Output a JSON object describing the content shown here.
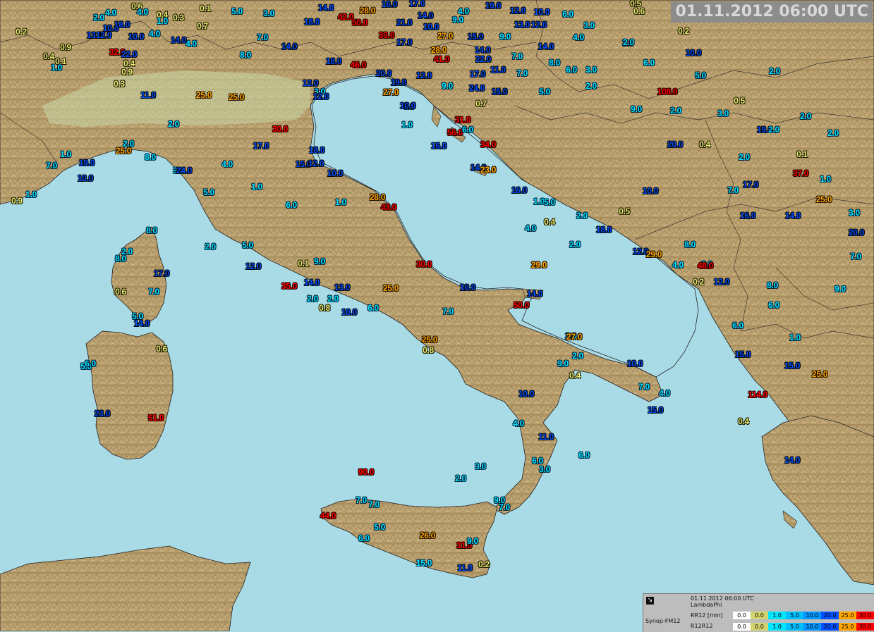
{
  "header": {
    "timestamp": "01.11.2012 06:00 UTC"
  },
  "legend": {
    "icon": "arrow-icon",
    "time": "01.11.2012 06:00 UTC",
    "projection": "LambdaPhi",
    "row1_label": "RR12 [mm]",
    "row2_label": "R12R12",
    "brand": "Synop-FM12",
    "swatches": [
      {
        "label": "0.0",
        "color": "#ffffff",
        "text": "#000000"
      },
      {
        "label": "0.0",
        "color": "#d2d26e",
        "text": "#000000"
      },
      {
        "label": "1.0",
        "color": "#00e6ff",
        "text": "#000000"
      },
      {
        "label": "5.0",
        "color": "#00bfff",
        "text": "#000000"
      },
      {
        "label": "10.0",
        "color": "#0096ff",
        "text": "#000000"
      },
      {
        "label": "20.0",
        "color": "#0050ff",
        "text": "#000000"
      },
      {
        "label": "25.0",
        "color": "#ffa500",
        "text": "#000000"
      },
      {
        "label": "30.0",
        "color": "#ff0000",
        "text": "#000000"
      }
    ]
  },
  "observations": [
    {
      "v": "4.0",
      "c": "c"
    },
    {
      "v": "0.6",
      "c": "y"
    },
    {
      "v": "4.0",
      "c": "c"
    },
    {
      "v": "0.4",
      "c": "y"
    },
    {
      "v": "0.3",
      "c": "y"
    },
    {
      "v": "0.1",
      "c": "y"
    },
    {
      "v": "5.0",
      "c": "c"
    },
    {
      "v": "3.0",
      "c": "c"
    },
    {
      "v": "14.0",
      "c": "b"
    },
    {
      "v": "42.0",
      "c": "r"
    },
    {
      "v": "28.0",
      "c": "o"
    },
    {
      "v": "16.0",
      "c": "b"
    },
    {
      "v": "17.0",
      "c": "b"
    },
    {
      "v": "4.0",
      "c": "c"
    },
    {
      "v": "19.0",
      "c": "b"
    },
    {
      "v": "12.0",
      "c": "b"
    },
    {
      "v": "10.0",
      "c": "b"
    },
    {
      "v": "6.0",
      "c": "c"
    },
    {
      "v": "0.5",
      "c": "y"
    },
    {
      "v": "0.6",
      "c": "y"
    },
    {
      "v": "0.2",
      "c": "y"
    },
    {
      "v": "2.0",
      "c": "c"
    },
    {
      "v": "10.0",
      "c": "b"
    },
    {
      "v": "18.0",
      "c": "b"
    },
    {
      "v": "1.0",
      "c": "c"
    },
    {
      "v": "0.7",
      "c": "y"
    },
    {
      "v": "18.0",
      "c": "b"
    },
    {
      "v": "50.0",
      "c": "r"
    },
    {
      "v": "21.0",
      "c": "b"
    },
    {
      "v": "14.0",
      "c": "b"
    },
    {
      "v": "9.0",
      "c": "c"
    },
    {
      "v": "10.0",
      "c": "b"
    },
    {
      "v": "13.0",
      "c": "b"
    },
    {
      "v": "3.0",
      "c": "c"
    },
    {
      "v": "0.2",
      "c": "y"
    },
    {
      "v": "13.0",
      "c": "b"
    },
    {
      "v": "12.0",
      "c": "b"
    },
    {
      "v": "10.0",
      "c": "b"
    },
    {
      "v": "14.0",
      "c": "b"
    },
    {
      "v": "4.0",
      "c": "c"
    },
    {
      "v": "7.0",
      "c": "c"
    },
    {
      "v": "33.0",
      "c": "r"
    },
    {
      "v": "17.0",
      "c": "b"
    },
    {
      "v": "27.0",
      "c": "o"
    },
    {
      "v": "15.0",
      "c": "b"
    },
    {
      "v": "9.0",
      "c": "c"
    },
    {
      "v": "12.0",
      "c": "b"
    },
    {
      "v": "4.0",
      "c": "c"
    },
    {
      "v": "3.0",
      "c": "c"
    },
    {
      "v": "0.9",
      "c": "y"
    },
    {
      "v": "32.0",
      "c": "r"
    },
    {
      "v": "22.0",
      "c": "b"
    },
    {
      "v": "14.0",
      "c": "b"
    },
    {
      "v": "4.0",
      "c": "c"
    },
    {
      "v": "8.0",
      "c": "c"
    },
    {
      "v": "14.0",
      "c": "b"
    },
    {
      "v": "28.0",
      "c": "o"
    },
    {
      "v": "14.0",
      "c": "b"
    },
    {
      "v": "10.0",
      "c": "b"
    },
    {
      "v": "0.4",
      "c": "y"
    },
    {
      "v": "0.1",
      "c": "y"
    },
    {
      "v": "1.0",
      "c": "c"
    },
    {
      "v": "0.4",
      "c": "y"
    },
    {
      "v": "18.0",
      "c": "b"
    },
    {
      "v": "46.0",
      "c": "r"
    },
    {
      "v": "41.0",
      "c": "r"
    },
    {
      "v": "22.0",
      "c": "b"
    },
    {
      "v": "7.0",
      "c": "c"
    },
    {
      "v": "8.0",
      "c": "c"
    },
    {
      "v": "6.0",
      "c": "c"
    },
    {
      "v": "0.9",
      "c": "y"
    },
    {
      "v": "20.0",
      "c": "b"
    },
    {
      "v": "12.0",
      "c": "b"
    },
    {
      "v": "17.0",
      "c": "b"
    },
    {
      "v": "11.0",
      "c": "b"
    },
    {
      "v": "7.0",
      "c": "c"
    },
    {
      "v": "6.0",
      "c": "c"
    },
    {
      "v": "3.0",
      "c": "c"
    },
    {
      "v": "5.0",
      "c": "c"
    },
    {
      "v": "2.0",
      "c": "c"
    },
    {
      "v": "0.3",
      "c": "y"
    },
    {
      "v": "11.0",
      "c": "b"
    },
    {
      "v": "25.0",
      "c": "o"
    },
    {
      "v": "25.0",
      "c": "o"
    },
    {
      "v": "12.0",
      "c": "b"
    },
    {
      "v": "19.0",
      "c": "b"
    },
    {
      "v": "9.0",
      "c": "c"
    },
    {
      "v": "24.0",
      "c": "b"
    },
    {
      "v": "15.0",
      "c": "b"
    },
    {
      "v": "5.0",
      "c": "c"
    },
    {
      "v": "2.0",
      "c": "c"
    },
    {
      "v": "2.0",
      "c": "c"
    },
    {
      "v": "3.0",
      "c": "c"
    },
    {
      "v": "27.0",
      "c": "o"
    },
    {
      "v": "12.0",
      "c": "b"
    },
    {
      "v": "0.5",
      "c": "y"
    },
    {
      "v": "0.7",
      "c": "y"
    },
    {
      "v": "9.0",
      "c": "c"
    },
    {
      "v": "10.0",
      "c": "b"
    },
    {
      "v": "108.0",
      "c": "r"
    },
    {
      "v": "9.0",
      "c": "c"
    },
    {
      "v": "2.0",
      "c": "c"
    },
    {
      "v": "3.0",
      "c": "c"
    },
    {
      "v": "2.0",
      "c": "c"
    },
    {
      "v": "2.0",
      "c": "c"
    },
    {
      "v": "31.0",
      "c": "r"
    },
    {
      "v": "1.0",
      "c": "c"
    },
    {
      "v": "56.0",
      "c": "r"
    },
    {
      "v": "6.0",
      "c": "c"
    },
    {
      "v": "30.0",
      "c": "r"
    },
    {
      "v": "19.0",
      "c": "b"
    },
    {
      "v": "2.0",
      "c": "c"
    },
    {
      "v": "2.0",
      "c": "c"
    },
    {
      "v": "2.0",
      "c": "c"
    },
    {
      "v": "25.0",
      "c": "o"
    },
    {
      "v": "17.0",
      "c": "b"
    },
    {
      "v": "15.0",
      "c": "b"
    },
    {
      "v": "34.0",
      "c": "r"
    },
    {
      "v": "20.0",
      "c": "b"
    },
    {
      "v": "0.4",
      "c": "y"
    },
    {
      "v": "2.0",
      "c": "c"
    },
    {
      "v": "0.1",
      "c": "y"
    },
    {
      "v": "1.0",
      "c": "c"
    },
    {
      "v": "8.0",
      "c": "c"
    },
    {
      "v": "18.0",
      "c": "b"
    },
    {
      "v": "15.0",
      "c": "b"
    },
    {
      "v": "19.0",
      "c": "b"
    },
    {
      "v": "4.0",
      "c": "c"
    },
    {
      "v": "7.0",
      "c": "c"
    },
    {
      "v": "12.0",
      "c": "b"
    },
    {
      "v": "10.0",
      "c": "b"
    },
    {
      "v": "14.0",
      "c": "b"
    },
    {
      "v": "23.0",
      "c": "o"
    },
    {
      "v": "37.0",
      "c": "r"
    },
    {
      "v": "3.0",
      "c": "c"
    },
    {
      "v": "24.0",
      "c": "b"
    },
    {
      "v": "10.0",
      "c": "b"
    },
    {
      "v": "5.0",
      "c": "c"
    },
    {
      "v": "1.0",
      "c": "c"
    },
    {
      "v": "16.0",
      "c": "b"
    },
    {
      "v": "10.0",
      "c": "b"
    },
    {
      "v": "7.0",
      "c": "c"
    },
    {
      "v": "17.0",
      "c": "b"
    },
    {
      "v": "1.0",
      "c": "c"
    },
    {
      "v": "0.9",
      "c": "y"
    },
    {
      "v": "1.0",
      "c": "c"
    },
    {
      "v": "6.0",
      "c": "c"
    },
    {
      "v": "1.0",
      "c": "c"
    },
    {
      "v": "28.0",
      "c": "o"
    },
    {
      "v": "43.0",
      "c": "r"
    },
    {
      "v": "1.0",
      "c": "c"
    },
    {
      "v": "5.0",
      "c": "c"
    },
    {
      "v": "25.0",
      "c": "o"
    },
    {
      "v": "3.0",
      "c": "c"
    },
    {
      "v": "2.0",
      "c": "c"
    },
    {
      "v": "0.5",
      "c": "y"
    },
    {
      "v": "16.0",
      "c": "b"
    },
    {
      "v": "14.0",
      "c": "b"
    },
    {
      "v": "0.4",
      "c": "y"
    },
    {
      "v": "4.0",
      "c": "c"
    },
    {
      "v": "18.0",
      "c": "b"
    },
    {
      "v": "20.0",
      "c": "b"
    },
    {
      "v": "8.0",
      "c": "c"
    },
    {
      "v": "2.0",
      "c": "c"
    },
    {
      "v": "2.0",
      "c": "c"
    },
    {
      "v": "5.0",
      "c": "c"
    },
    {
      "v": "8.0",
      "c": "c"
    },
    {
      "v": "2.0",
      "c": "c"
    },
    {
      "v": "8.0",
      "c": "c"
    },
    {
      "v": "12.0",
      "c": "b"
    },
    {
      "v": "29.0",
      "c": "o"
    },
    {
      "v": "7.0",
      "c": "c"
    },
    {
      "v": "12.0",
      "c": "b"
    },
    {
      "v": "0.1",
      "c": "y"
    },
    {
      "v": "9.0",
      "c": "c"
    },
    {
      "v": "30.0",
      "c": "r"
    },
    {
      "v": "29.0",
      "c": "o"
    },
    {
      "v": "4.0",
      "c": "c"
    },
    {
      "v": "3.0",
      "c": "c"
    },
    {
      "v": "17.0",
      "c": "b"
    },
    {
      "v": "48.0",
      "c": "r"
    },
    {
      "v": "0.6",
      "c": "y"
    },
    {
      "v": "35.0",
      "c": "r"
    },
    {
      "v": "14.0",
      "c": "b"
    },
    {
      "v": "13.0",
      "c": "b"
    },
    {
      "v": "25.0",
      "c": "o"
    },
    {
      "v": "10.0",
      "c": "b"
    },
    {
      "v": "14.0",
      "c": "b"
    },
    {
      "v": "0.2",
      "c": "y"
    },
    {
      "v": "12.0",
      "c": "b"
    },
    {
      "v": "8.0",
      "c": "c"
    },
    {
      "v": "9.0",
      "c": "c"
    },
    {
      "v": "7.0",
      "c": "c"
    },
    {
      "v": "2.0",
      "c": "c"
    },
    {
      "v": "2.0",
      "c": "c"
    },
    {
      "v": "0.8",
      "c": "y"
    },
    {
      "v": "10.0",
      "c": "b"
    },
    {
      "v": "6.0",
      "c": "c"
    },
    {
      "v": "7.0",
      "c": "c"
    },
    {
      "v": "50.0",
      "c": "r"
    },
    {
      "v": "6.0",
      "c": "c"
    },
    {
      "v": "5.0",
      "c": "c"
    },
    {
      "v": "14.0",
      "c": "b"
    },
    {
      "v": "6.0",
      "c": "c"
    },
    {
      "v": "2.0",
      "c": "c"
    },
    {
      "v": "27.0",
      "c": "o"
    },
    {
      "v": "1.0",
      "c": "c"
    },
    {
      "v": "0.6",
      "c": "y"
    },
    {
      "v": "25.0",
      "c": "o"
    },
    {
      "v": "0.8",
      "c": "y"
    },
    {
      "v": "2.0",
      "c": "c"
    },
    {
      "v": "9.0",
      "c": "c"
    },
    {
      "v": "10.0",
      "c": "b"
    },
    {
      "v": "15.0",
      "c": "b"
    },
    {
      "v": "15.0",
      "c": "b"
    },
    {
      "v": "25.0",
      "c": "o"
    },
    {
      "v": "5.0",
      "c": "c"
    },
    {
      "v": "6.0",
      "c": "c"
    },
    {
      "v": "0.4",
      "c": "y"
    },
    {
      "v": "7.0",
      "c": "c"
    },
    {
      "v": "4.0",
      "c": "c"
    },
    {
      "v": "10.0",
      "c": "b"
    },
    {
      "v": "114.0",
      "c": "r"
    },
    {
      "v": "15.0",
      "c": "b"
    },
    {
      "v": "23.0",
      "c": "b"
    },
    {
      "v": "51.0",
      "c": "r"
    },
    {
      "v": "4.0",
      "c": "c"
    },
    {
      "v": "0.4",
      "c": "y"
    },
    {
      "v": "11.0",
      "c": "b"
    },
    {
      "v": "6.0",
      "c": "c"
    },
    {
      "v": "3.0",
      "c": "c"
    },
    {
      "v": "6.0",
      "c": "c"
    },
    {
      "v": "14.0",
      "c": "b"
    },
    {
      "v": "90.0",
      "c": "r"
    },
    {
      "v": "3.0",
      "c": "c"
    },
    {
      "v": "2.0",
      "c": "c"
    },
    {
      "v": "9.0",
      "c": "c"
    },
    {
      "v": "7.0",
      "c": "c"
    },
    {
      "v": "7.0",
      "c": "c"
    },
    {
      "v": "7.0",
      "c": "c"
    },
    {
      "v": "44.0",
      "c": "r"
    },
    {
      "v": "5.0",
      "c": "c"
    },
    {
      "v": "6.0",
      "c": "c"
    },
    {
      "v": "26.0",
      "c": "o"
    },
    {
      "v": "31.0",
      "c": "r"
    },
    {
      "v": "9.0",
      "c": "c"
    },
    {
      "v": "15.0",
      "c": "c"
    },
    {
      "v": "11.0",
      "c": "b"
    },
    {
      "v": "0.2",
      "c": "y"
    },
    {
      "v": "3.0",
      "c": "c"
    },
    {
      "v": "1.0",
      "c": "c"
    }
  ]
}
